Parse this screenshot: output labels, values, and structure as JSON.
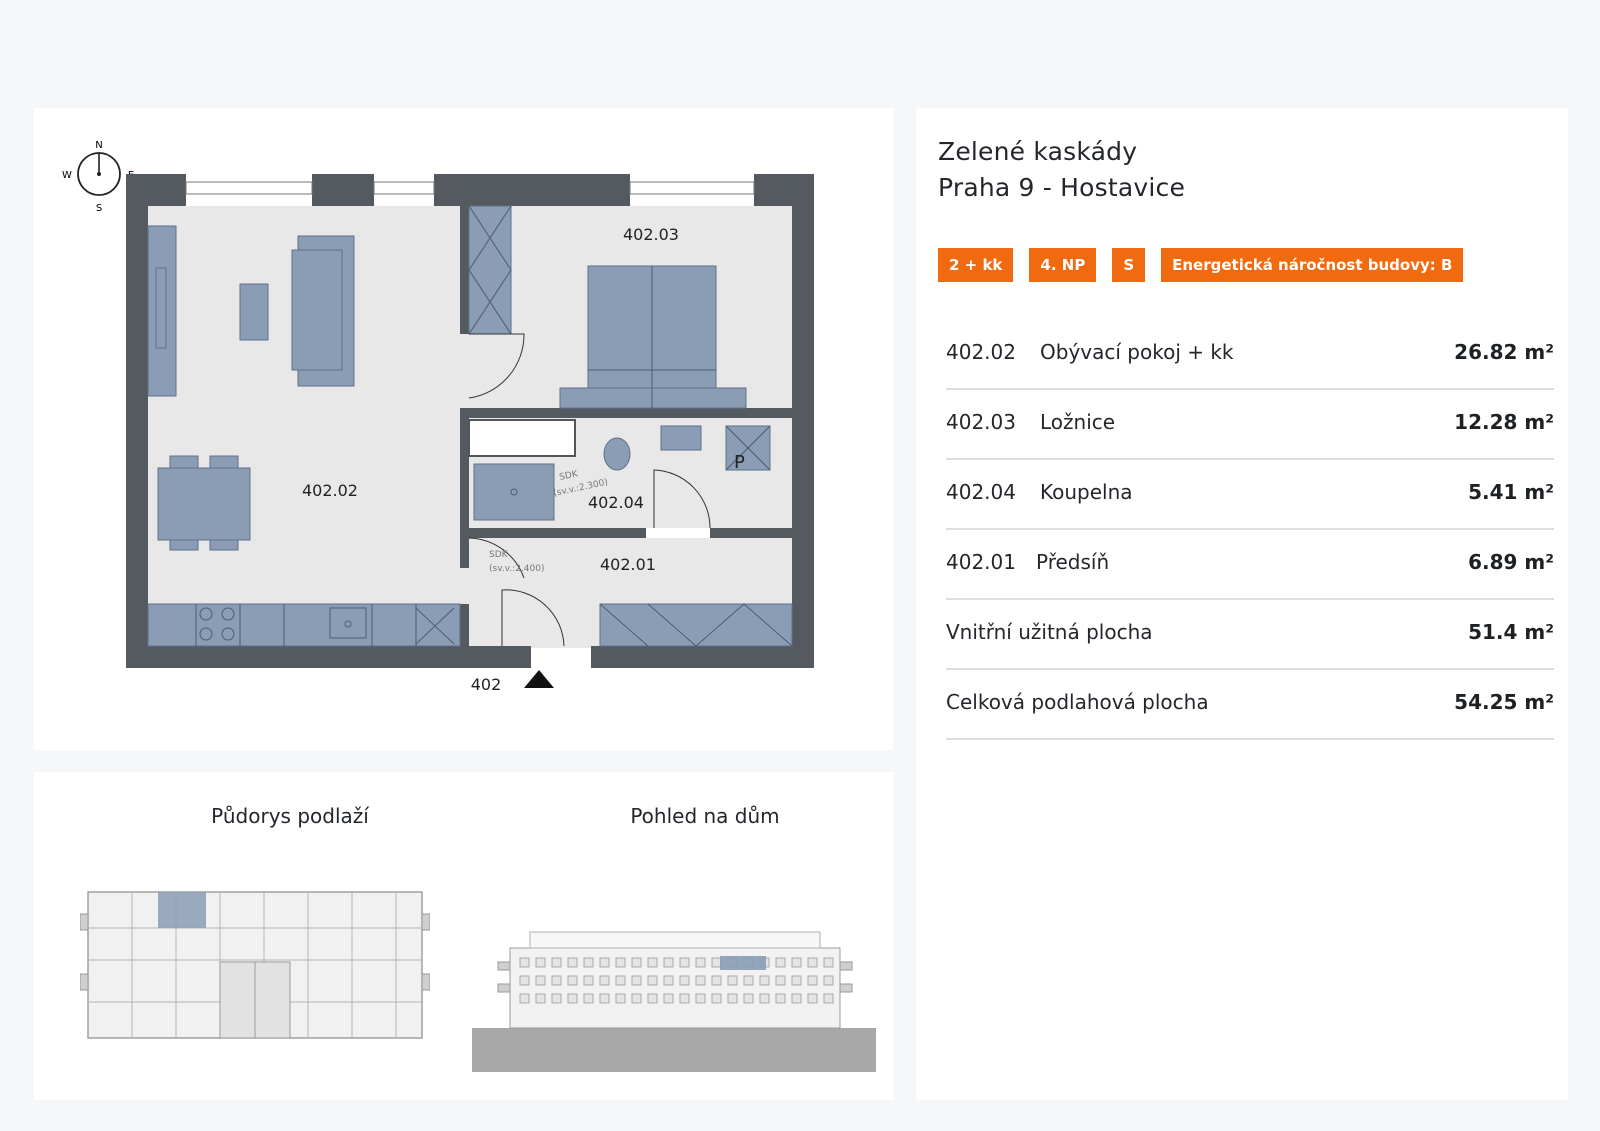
{
  "project": {
    "name": "Zelené kaskády",
    "location": "Praha 9 - Hostavice"
  },
  "badges": [
    {
      "label": "2 + kk"
    },
    {
      "label": "4. NP"
    },
    {
      "label": "S"
    },
    {
      "label": "Energetická náročnost budovy: B"
    }
  ],
  "rooms": [
    {
      "code": "402.02",
      "name": "Obývací pokoj + kk",
      "area": "26.82 m²"
    },
    {
      "code": "402.03",
      "name": "Ložnice",
      "area": "12.28 m²"
    },
    {
      "code": "402.04",
      "name": "Koupelna",
      "area": "5.41 m²"
    },
    {
      "code": "402.01",
      "name": "Předsíň",
      "area": "6.89 m²"
    }
  ],
  "totals": [
    {
      "name": "Vnitřní užitná plocha",
      "area": "51.4 m²"
    },
    {
      "name": "Celková podlahová plocha",
      "area": "54.25 m²"
    }
  ],
  "floorplan": {
    "compass": {
      "n": "N",
      "w": "W",
      "e": "E",
      "s": "S"
    },
    "room_labels": {
      "living": "402.02",
      "bedroom": "402.03",
      "bathroom": "402.04",
      "hall": "402.01"
    },
    "unit_number": "402",
    "sdk_label_1": "SDK",
    "sdk_height_1": "(sv.v.:2.300)",
    "sdk_label_2": "SDK",
    "sdk_height_2": "(sv.v.:2.400)",
    "p_label": "P"
  },
  "mini": {
    "floor_title": "Půdorys podlaží",
    "house_title": "Pohled na dům"
  },
  "colors": {
    "accent": "#f26a0f",
    "wall": "#555a60",
    "furniture": "#8a9db5",
    "floor": "#e8e8e8"
  }
}
